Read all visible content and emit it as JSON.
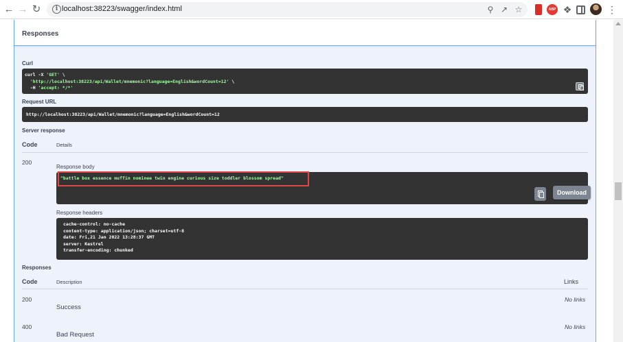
{
  "browser": {
    "url": "localhost:38223/swagger/index.html",
    "back_icon": "arrow-left-icon",
    "forward_icon": "arrow-right-icon",
    "reload_icon": "reload-icon",
    "abp_label": "ABP"
  },
  "responses_section": {
    "header": "Responses"
  },
  "curl": {
    "label": "Curl",
    "lines": [
      "curl -X 'GET' \\",
      "  'http://localhost:38223/api/Wallet/mnemonic?language=English&wordCount=12' \\",
      "  -H 'accept: */*'"
    ]
  },
  "request_url": {
    "label": "Request URL",
    "value": "http://localhost:38223/api/Wallet/mnemonic?language=English&wordCount=12"
  },
  "server_response": {
    "label": "Server response",
    "code_header": "Code",
    "details_header": "Details",
    "code": "200",
    "body_label": "Response body",
    "body": "\"battle box essence muffin nominee twin engine curious size toddler blossom spread\"",
    "download_label": "Download",
    "headers_label": "Response headers",
    "headers": [
      "cache-control: no-cache",
      "content-type: application/json; charset=utf-8",
      "date: Fri,21 Jan 2022 13:28:37 GMT",
      "server: Kestrel",
      "transfer-encoding: chunked"
    ]
  },
  "responses_table": {
    "label": "Responses",
    "code_header": "Code",
    "description_header": "Description",
    "links_header": "Links",
    "rows": [
      {
        "code": "200",
        "description": "Success",
        "links": "No links"
      },
      {
        "code": "400",
        "description": "Bad Request",
        "links": "No links"
      }
    ]
  },
  "colors": {
    "accent_blue": "#61affe",
    "code_bg": "#333333",
    "string_green": "#a2fca2",
    "highlight_red": "#e04848"
  }
}
